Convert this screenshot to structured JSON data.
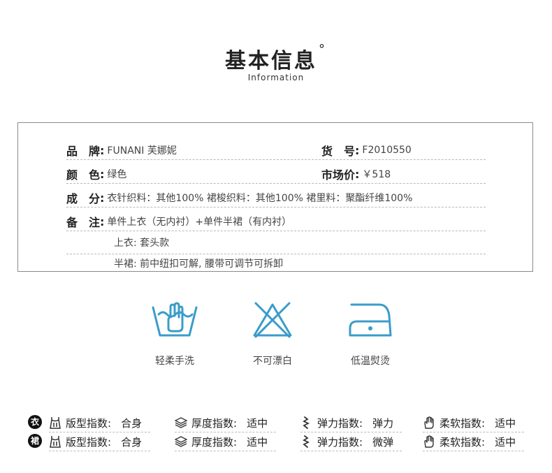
{
  "header": {
    "title": "基本信息",
    "degree": "°",
    "subtitle": "Information"
  },
  "info": {
    "brand_label": "品　牌",
    "brand_value": "FUNANI 芙娜妮",
    "sku_label": "货　号",
    "sku_value": "F2010550",
    "color_label": "颜　色",
    "color_value": "绿色",
    "price_label": "市场价",
    "price_value": "￥518",
    "comp_label": "成　分",
    "comp_value": "衣针织料：其他100% 裙梭织料：其他100% 裙里料：聚酯纤维100%",
    "note_label": "备　注",
    "note_line1": "单件上衣（无内衬）+单件半裙（有内衬）",
    "note_line2": "上衣: 套头款",
    "note_line3": "半裙: 前中纽扣可解, 腰带可调节可拆卸",
    "colon": ":"
  },
  "care": [
    {
      "icon": "hand-wash-icon",
      "label": "轻柔手洗"
    },
    {
      "icon": "no-bleach-icon",
      "label": "不可漂白"
    },
    {
      "icon": "low-iron-icon",
      "label": "低温熨烫"
    }
  ],
  "indices": [
    {
      "badge": "衣",
      "fit_label": "版型指数:",
      "fit_value": "合身",
      "thick_label": "厚度指数:",
      "thick_value": "适中",
      "elastic_label": "弹力指数:",
      "elastic_value": "弹力",
      "soft_label": "柔软指数:",
      "soft_value": "适中"
    },
    {
      "badge": "裙",
      "fit_label": "版型指数:",
      "fit_value": "合身",
      "thick_label": "厚度指数:",
      "thick_value": "适中",
      "elastic_label": "弹力指数:",
      "elastic_value": "微弹",
      "soft_label": "柔软指数:",
      "soft_value": "适中"
    }
  ],
  "colors": {
    "care_icon": "#3a9cc9",
    "badge_bg": "#111111",
    "border": "#8a8a8a"
  }
}
